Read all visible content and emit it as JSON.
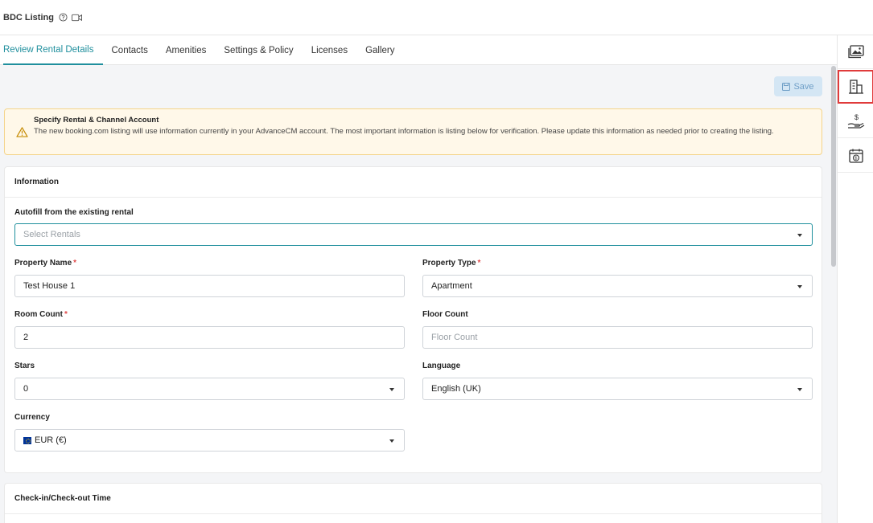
{
  "header": {
    "title": "BDC Listing",
    "help_icon": "help-circle-icon",
    "video_icon": "video-camera-icon"
  },
  "tabs": [
    {
      "label": "Review Rental Details",
      "active": true
    },
    {
      "label": "Contacts"
    },
    {
      "label": "Amenities"
    },
    {
      "label": "Settings & Policy"
    },
    {
      "label": "Licenses"
    },
    {
      "label": "Gallery"
    }
  ],
  "toolbar": {
    "save_label": "Save"
  },
  "alert": {
    "title": "Specify Rental & Channel Account",
    "body": "The new booking.com listing will use information currently in your AdvanceCM account. The most important information is listing below for verification. Please update this information as needed prior to creating the listing."
  },
  "info": {
    "heading": "Information",
    "autofill_label": "Autofill from the existing rental",
    "autofill_placeholder": "Select Rentals",
    "property_name_label": "Property Name",
    "property_name_value": "Test House 1",
    "property_type_label": "Property Type",
    "property_type_value": "Apartment",
    "room_count_label": "Room Count",
    "room_count_value": "2",
    "floor_count_label": "Floor Count",
    "floor_count_placeholder": "Floor Count",
    "stars_label": "Stars",
    "stars_value": "0",
    "language_label": "Language",
    "language_value": "English (UK)",
    "currency_label": "Currency",
    "currency_value": "EUR (€)",
    "required_mark": "*"
  },
  "checkin": {
    "heading": "Check-in/Check-out Time"
  },
  "sidebar": {
    "items": [
      {
        "icon": "gallery-icon"
      },
      {
        "icon": "building-icon",
        "selected": true
      },
      {
        "icon": "payment-hand-icon"
      },
      {
        "icon": "calendar-dollar-icon"
      }
    ]
  },
  "colors": {
    "accent": "#1f8f9d",
    "required": "#e04a4a",
    "alert_bg": "#fff8e9",
    "selected_outline": "#e03b3b"
  }
}
